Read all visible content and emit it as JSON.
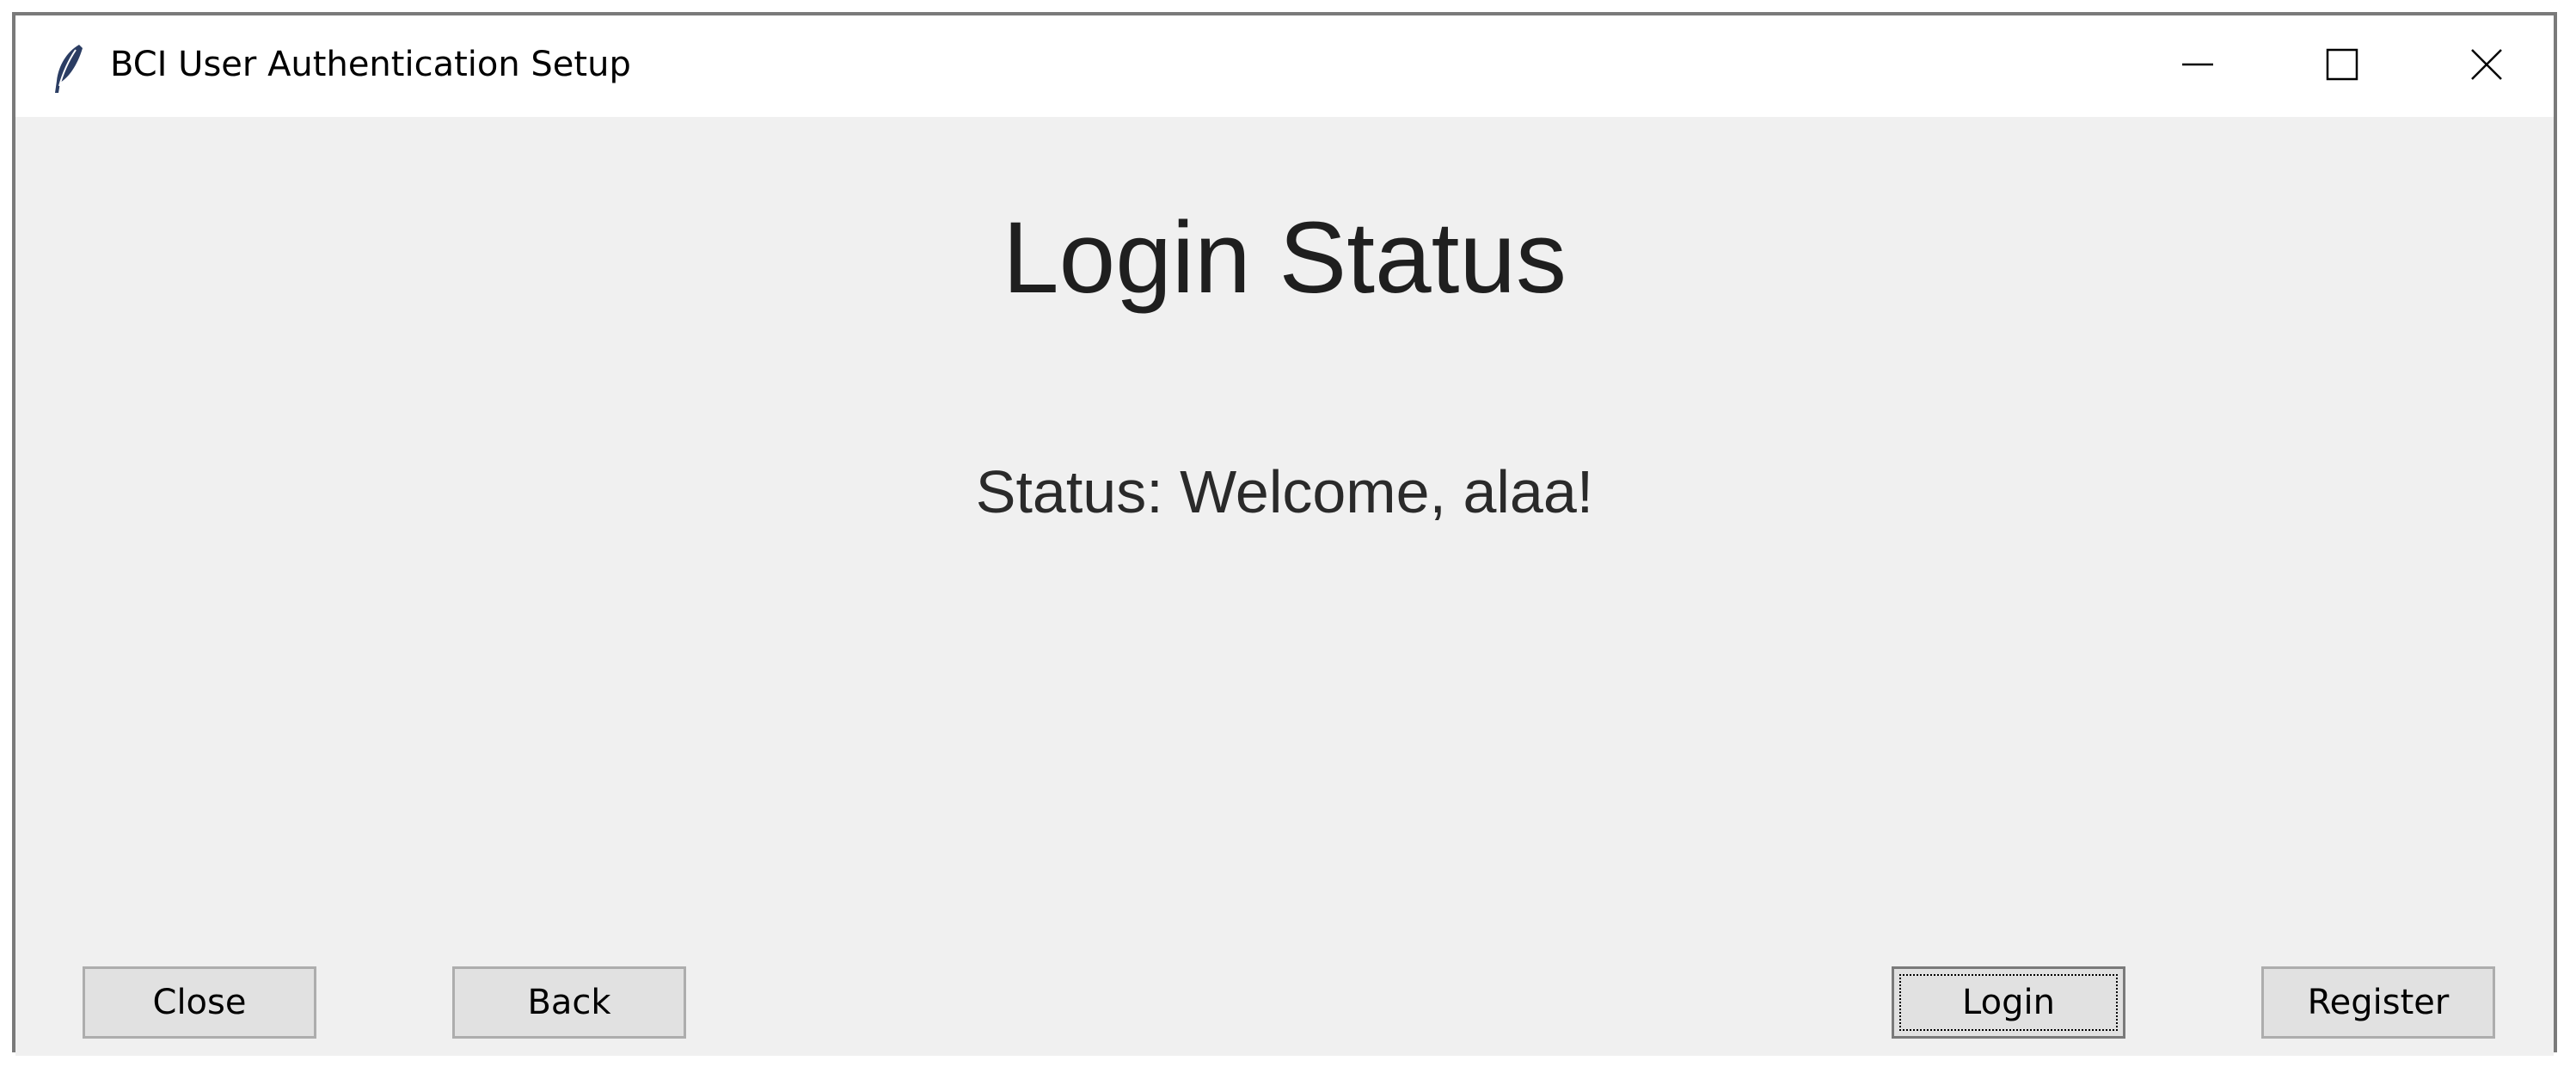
{
  "window": {
    "title": "BCI User Authentication Setup",
    "app_icon": "feather-icon",
    "controls": {
      "minimize_icon": "minimize-icon",
      "maximize_icon": "maximize-icon",
      "close_icon": "close-icon"
    }
  },
  "main": {
    "heading": "Login Status",
    "status_text": "Status: Welcome, alaa!"
  },
  "buttons": {
    "close_label": "Close",
    "back_label": "Back",
    "login_label": "Login",
    "register_label": "Register"
  },
  "colors": {
    "window_background": "#f0f0f0",
    "titlebar_background": "#ffffff",
    "button_face": "#e1e1e1",
    "button_border": "#adadad"
  }
}
